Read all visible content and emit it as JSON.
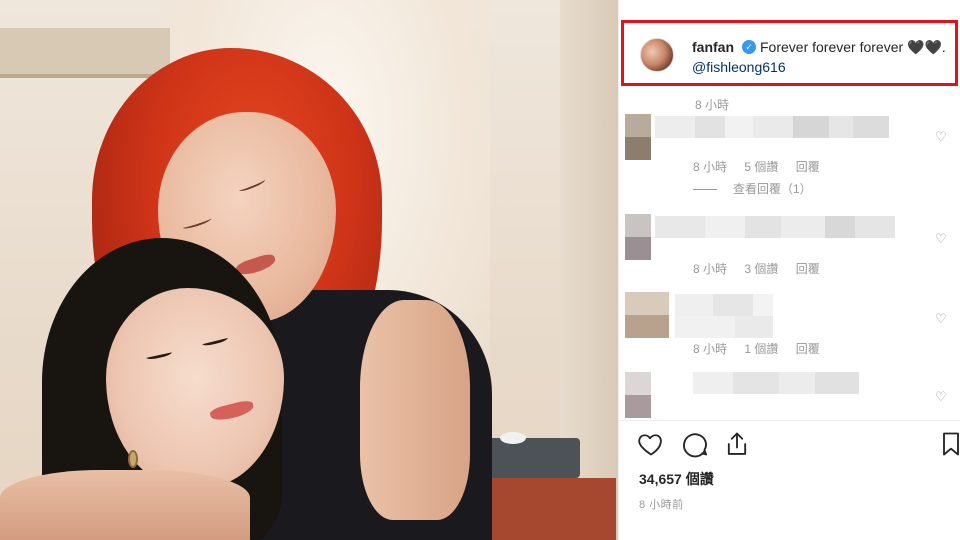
{
  "post": {
    "username": "fanfan",
    "caption": "Forever forever forever 🖤🖤.",
    "mention": "@fishleong616",
    "time": "8 小時",
    "likes": "34,657 個讚",
    "posted_ago": "8 小時前"
  },
  "comments": [
    {
      "time": "8 小時",
      "likes": "5 個讚",
      "reply": "回覆",
      "view_replies": "查看回覆（1）"
    },
    {
      "time": "8 小時",
      "likes": "3 個讚",
      "reply": "回覆"
    },
    {
      "time": "8 小時",
      "likes": "1 個讚",
      "reply": "回覆"
    },
    {
      "time": "",
      "likes": "",
      "reply": ""
    }
  ],
  "icons": {
    "verified": "verified-badge-icon",
    "heart": "heart-icon",
    "comment": "comment-icon",
    "share": "share-icon",
    "save": "bookmark-icon"
  },
  "colors": {
    "highlight_box": "#e0131a",
    "verified_blue": "#3897f0",
    "mention": "#003569",
    "muted_text": "#999999"
  }
}
